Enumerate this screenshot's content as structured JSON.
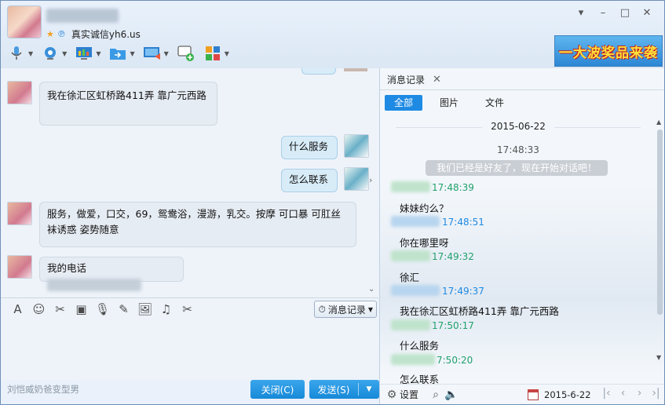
{
  "header": {
    "signature": "真实诚信yh6.us",
    "window_controls": [
      "▾",
      "–",
      "□",
      "✕"
    ],
    "ad_text": "一大波奖品来袭"
  },
  "toolbar": {
    "items": [
      {
        "name": "voice-call",
        "icon": "🎙"
      },
      {
        "name": "video-call",
        "icon": "📷"
      },
      {
        "name": "remote-desktop",
        "icon": "📊"
      },
      {
        "name": "send-file",
        "icon": "📁"
      },
      {
        "name": "share-screen",
        "icon": "🖥"
      },
      {
        "name": "create-discussion",
        "icon": "💬"
      },
      {
        "name": "apps",
        "icon": "▦"
      }
    ]
  },
  "chat": {
    "messages": [
      {
        "side": "left",
        "text": "我在徐汇区虹桥路411弄 靠广元西路"
      },
      {
        "side": "right",
        "text": "什么服务"
      },
      {
        "side": "right",
        "text": "怎么联系"
      },
      {
        "side": "left",
        "text": "服务，做爱，口交，69，鸳鸯浴，漫游，乳交。按摩 可口暴 可肛丝袜诱惑 姿势随意"
      },
      {
        "side": "left",
        "text": "我的电话"
      }
    ]
  },
  "input_tools": {
    "icons": [
      "A",
      "☺",
      "✂",
      "▣",
      "🎙",
      "✎",
      "🖼",
      "♫",
      "✂"
    ],
    "history_label": "消息记录"
  },
  "footer": {
    "left_text": "刘恺威奶爸变型男",
    "close_label": "关闭(C)",
    "send_label": "发送(S)"
  },
  "history": {
    "tab_label": "消息记录",
    "filters": [
      "全部",
      "图片",
      "文件"
    ],
    "date": "2015-06-22",
    "sys_time": "17:48:33",
    "sys_note": "我们已经是好友了，现在开始对话吧！",
    "entries": [
      {
        "time": "17:48:39",
        "text": "妹妹约么？",
        "who": "green"
      },
      {
        "time": "17:48:51",
        "text": "你在哪里呀",
        "who": "blue"
      },
      {
        "time": "17:49:32",
        "text": "徐汇",
        "who": "green"
      },
      {
        "time": "17:49:37",
        "text": "我在徐汇区虹桥路411弄 靠广元西路",
        "who": "blue"
      },
      {
        "time": "17:50:17",
        "text": "什么服务",
        "who": "green"
      },
      {
        "time": "7:50:20",
        "text": "怎么联系",
        "who": "green"
      }
    ],
    "settings_label": "设置",
    "bottom_date": "2015-6-22"
  }
}
